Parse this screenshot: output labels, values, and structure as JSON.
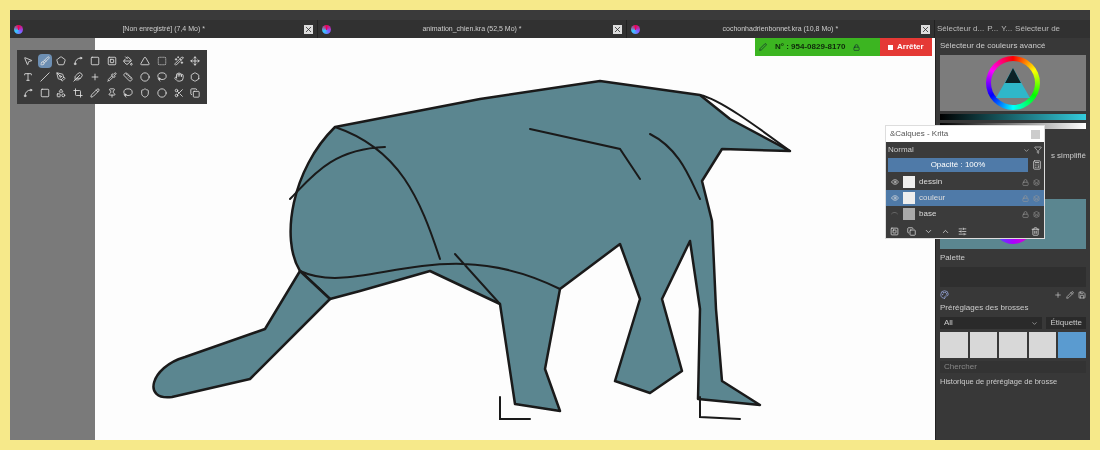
{
  "document_tabs": [
    {
      "label": "[Non enregistré]  (7,4 Mo) *"
    },
    {
      "label": "animation_chien.kra (52,5 Mo) *"
    },
    {
      "label": "cochonhadrienbonnet.kra (10,8 Mo) *"
    }
  ],
  "docker_tabs": [
    "Sélecteur d...",
    "P...",
    "Y...",
    "Sélecteur de"
  ],
  "recording": {
    "number": "N° : 954-0829-8170",
    "stop_label": "Arrêter"
  },
  "toolbox": {
    "tools": [
      {
        "selected": false
      },
      {
        "selected": true
      },
      {
        "selected": false
      },
      {
        "selected": false
      },
      {
        "selected": false
      },
      {
        "selected": false
      },
      {
        "selected": false
      },
      {
        "selected": false
      },
      {
        "selected": false
      },
      {
        "selected": false
      },
      {
        "selected": false
      },
      {
        "selected": false
      },
      {
        "selected": false
      },
      {
        "selected": false
      },
      {
        "selected": false
      },
      {
        "selected": false
      },
      {
        "selected": false
      },
      {
        "selected": false
      },
      {
        "selected": false
      },
      {
        "selected": false
      },
      {
        "selected": false
      },
      {
        "selected": false
      },
      {
        "selected": false
      },
      {
        "selected": false
      },
      {
        "selected": false
      },
      {
        "selected": false
      },
      {
        "selected": false
      },
      {
        "selected": false
      },
      {
        "selected": false
      },
      {
        "selected": false
      },
      {
        "selected": false
      },
      {
        "selected": false
      },
      {
        "selected": false
      }
    ]
  },
  "color_selector": {
    "title": "Sélecteur de couleurs avancé",
    "secondary_label": "s simplifié"
  },
  "layers_window": {
    "title": "&Calques - Krita",
    "blend_mode": "Normal",
    "opacity": {
      "label": "Opacité : 100%",
      "level": 1
    },
    "layers": [
      {
        "name": "dessin",
        "visible": true,
        "selected": false
      },
      {
        "name": "couleur",
        "visible": true,
        "selected": true
      },
      {
        "name": "base",
        "visible": false,
        "selected": false
      }
    ]
  },
  "palette": {
    "title": "Palette"
  },
  "brush_presets": {
    "title": "Préréglages des brosses",
    "filter": "All",
    "tag_label": "Étiquette",
    "search_placeholder": "Chercher",
    "presets": [
      {
        "selected": false
      },
      {
        "selected": false
      },
      {
        "selected": false
      },
      {
        "selected": false
      },
      {
        "selected": true
      }
    ]
  },
  "brush_history": {
    "title": "Historique de préréglage de brosse"
  }
}
